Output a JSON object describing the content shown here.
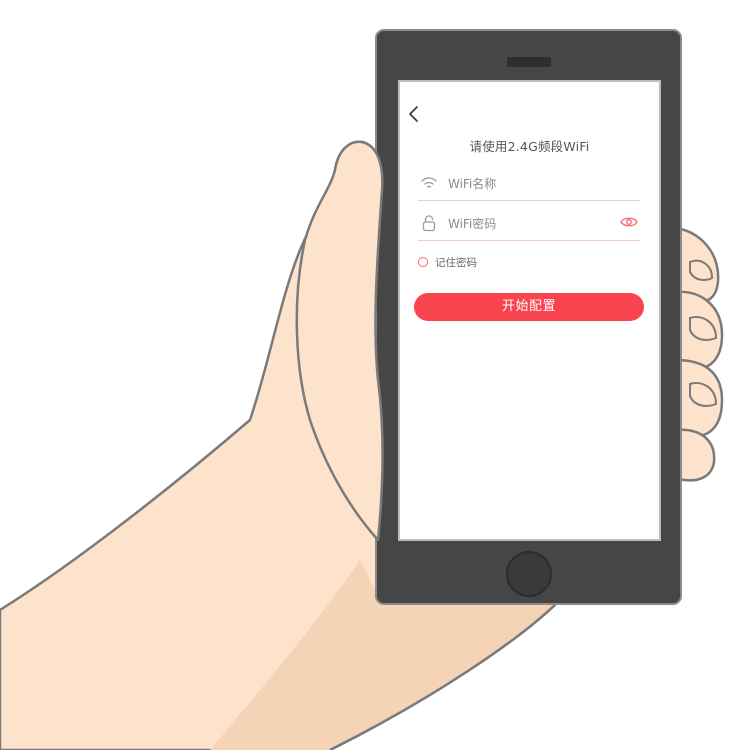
{
  "screen": {
    "title": "请使用2.4G频段WiFi",
    "wifi_field": {
      "placeholder": "WiFi名称",
      "value": ""
    },
    "password_field": {
      "placeholder": "WiFi密码",
      "value": ""
    },
    "remember_label": "记住密码",
    "start_button_label": "开始配置"
  },
  "icons": {
    "back": "back-arrow-icon",
    "wifi": "wifi-icon",
    "lock": "lock-icon",
    "eye": "eye-icon",
    "radio": "radio-circle-icon"
  },
  "colors": {
    "accent": "#f9434e",
    "field_underline": "#f3cfc8",
    "phone_body": "#464646",
    "skin": "#fde3cc",
    "skin_shadow": "#f5d3b6",
    "outline": "#7a7a7a"
  }
}
